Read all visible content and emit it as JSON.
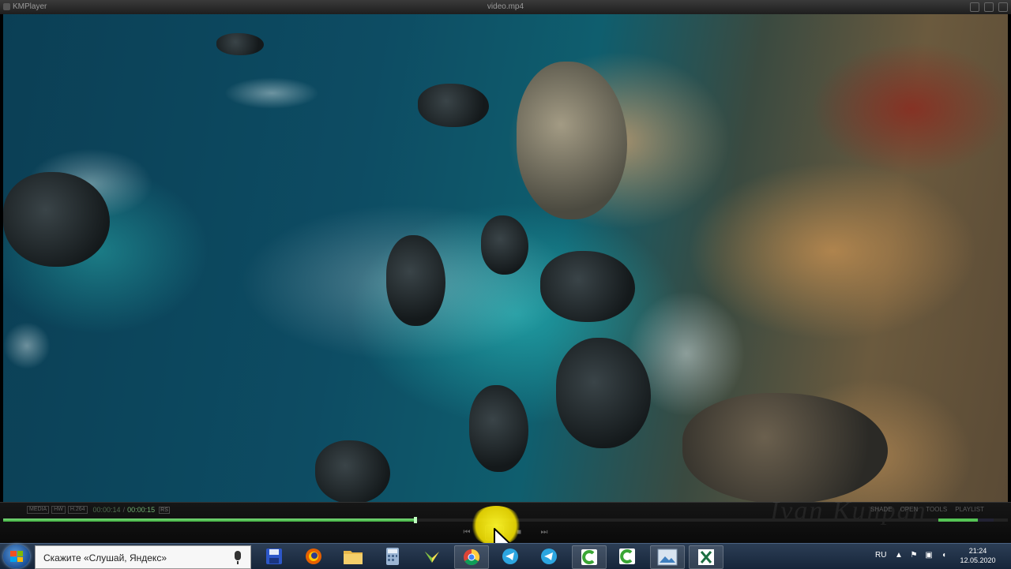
{
  "window": {
    "app_title": "KMPlayer",
    "file_title": "video.mp4"
  },
  "controls": {
    "tags": [
      "MEDIA",
      "HW",
      "H.264"
    ],
    "time_current": "00:00:14",
    "time_separator": "/",
    "time_total": "00:00:15",
    "rs_label": "RS",
    "menu": [
      "SHADE",
      "OPEN",
      "TOOLS",
      "PLAYLIST"
    ],
    "seek_progress": 0.41,
    "volume_level": 0.72,
    "watermark": "Ivan Kunpan"
  },
  "taskbar": {
    "search_placeholder": "Скажите «Слушай, Яндекс»",
    "apps": [
      "save-icon",
      "firefox-icon",
      "file-explorer-icon",
      "calculator-icon",
      "yandex-icon",
      "chrome-icon",
      "telegram-icon",
      "telegram-icon",
      "camtasia-icon",
      "camtasia-icon",
      "image-viewer-icon",
      "excel-icon"
    ],
    "language": "RU",
    "time": "21:24",
    "date": "12.05.2020"
  },
  "colors": {
    "seek_fill": "#4fc04f",
    "highlight": "#fff200",
    "taskbar": "#1e3048"
  }
}
